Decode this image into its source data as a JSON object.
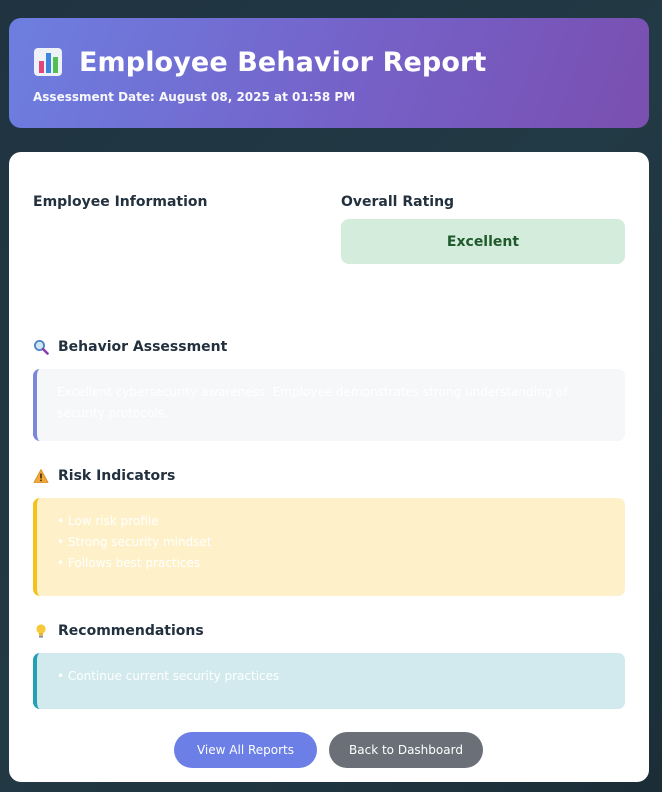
{
  "header": {
    "icon": "bar-chart-icon",
    "title": "Employee Behavior Report",
    "assessment_date": "Assessment Date: August 08, 2025 at 01:58 PM"
  },
  "employee": {
    "section_title": "Employee Information"
  },
  "rating": {
    "section_title": "Overall Rating",
    "value": "Excellent",
    "color": "#d4ecdb"
  },
  "behavior": {
    "icon": "magnifier-icon",
    "title": "Behavior Assessment",
    "text": "Excellent cybersecurity awareness. Employee demonstrates strong understanding of security protocols."
  },
  "risk": {
    "icon": "warning-icon",
    "title": "Risk Indicators",
    "items": [
      "• Low risk profile",
      "• Strong security mindset",
      "• Follows best practices"
    ]
  },
  "recommendations": {
    "icon": "lightbulb-icon",
    "title": "Recommendations",
    "items": [
      "• Continue current security practices"
    ]
  },
  "actions": {
    "view_reports": "View All Reports",
    "back_dashboard": "Back to Dashboard"
  }
}
